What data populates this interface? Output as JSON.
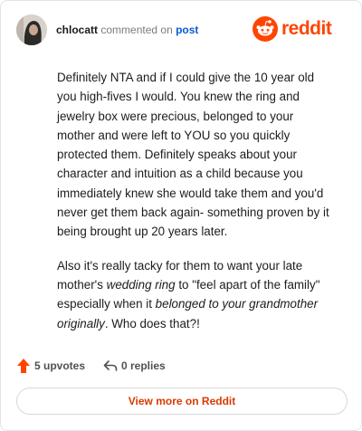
{
  "header": {
    "username": "chlocatt",
    "action_text": "commented on",
    "post_link": "post",
    "brand": "reddit"
  },
  "comment": {
    "p1": "Definitely NTA and if I could give the 10 year old you high-fives I would. You knew the ring and jewelry box were precious, belonged to your mother and were left to YOU so you quickly protected them. Definitely speaks about your character and intuition as a child because you immediately knew she would take them and you'd never get them back again- something proven by it being brought up 20 years later.",
    "p2_a": "Also it's really tacky for them to want your late mother's ",
    "p2_em1": "wedding ring",
    "p2_b": " to \"feel apart of the family\" especially when it ",
    "p2_em2": "belonged to your grandmother originally",
    "p2_c": ". Who does that?!"
  },
  "actions": {
    "upvotes": "5 upvotes",
    "replies": "0 replies"
  },
  "footer": {
    "view_more": "View more on Reddit"
  },
  "colors": {
    "accent": "#ff4500",
    "link": "#0a5ccf"
  }
}
